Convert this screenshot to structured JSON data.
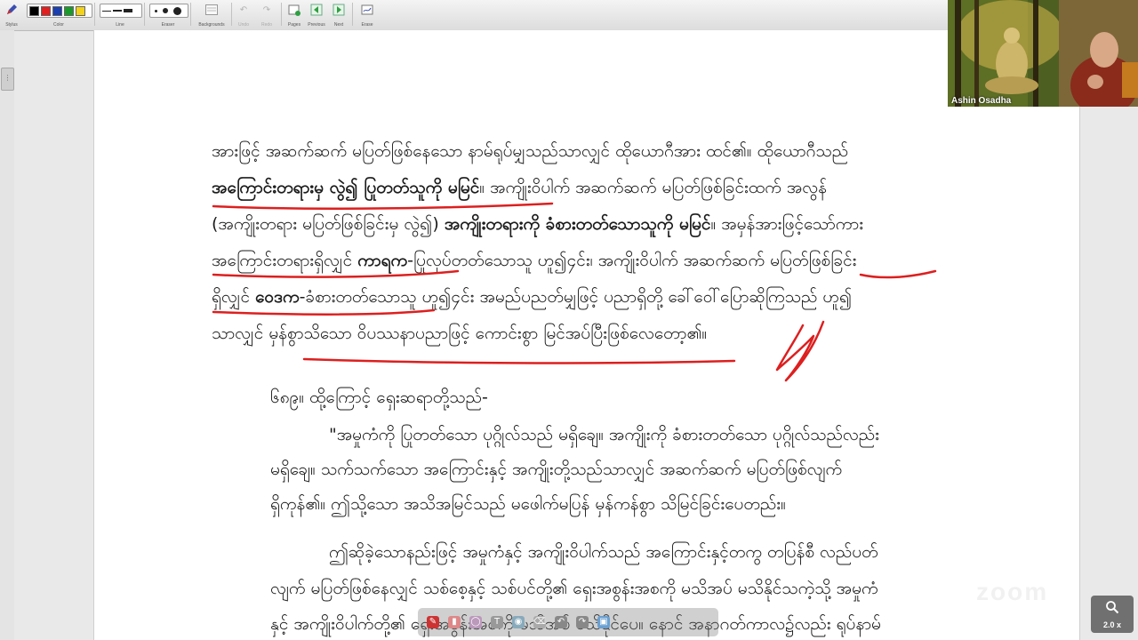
{
  "toolbar": {
    "groups": [
      {
        "label": "Stylus"
      },
      {
        "label": "Color"
      },
      {
        "label": "Line"
      },
      {
        "label": "Eraser"
      },
      {
        "label": "Backgrounds"
      },
      {
        "label": "Undo"
      },
      {
        "label": "Redo"
      },
      {
        "label": "Pages"
      },
      {
        "label": "Previous"
      },
      {
        "label": "Next"
      },
      {
        "label": "Erase"
      }
    ],
    "colors": [
      "#000000",
      "#e02020",
      "#1c3fb0",
      "#1a9a2a",
      "#f2d21b"
    ]
  },
  "video": {
    "participant_name": "Ashin Osadha"
  },
  "zoom": {
    "level": "2.0 x"
  },
  "document": {
    "para1": [
      "အားဖြင့် အဆက်ဆက် မပြတ်ဖြစ်နေသော နာမ်ရုပ်မျှသည်သာလျှင် ထိုယောဂီအား ထင်၏။ ထိုယောဂီသည်",
      "အကြောင်းတရားမှ လွဲ၍ ပြုတတ်သူကို မမြင်",
      "။ အကျိုးဝိပါက် အဆက်ဆက် မပြတ်ဖြစ်ခြင်းထက် အလွန်",
      "(အကျိုးတရား မပြတ်ဖြစ်ခြင်းမှ လွဲ၍)",
      "အကျိုးတရားကို ခံစားတတ်သောသူကို မမြင်",
      "။ အမှန်အားဖြင့်သော်ကား",
      "အကြောင်းတရားရှိလျှင်",
      "ကာရက",
      "-ပြုလုပ်တတ်သောသူ ဟူ၍၄င်း၊ အကျိုးဝိပါက် အဆက်ဆက် မပြတ်ဖြစ်ခြင်း",
      "ရှိလျှင်",
      "ဝေဒက",
      "-ခံစားတတ်သောသူ ဟူ၍၄င်း အမည်ပညတ်မျှဖြင့် ပညာရှိတို့ ခေါ်ဝေါ်ပြောဆိုကြသည် ဟူ၍",
      "သာလျှင် မှန်စွာသိသော ဝိပဿနာပညာဖြင့် ကောင်းစွာ မြင်အပ်ပြီးဖြစ်လေတော့၏။"
    ],
    "para2": {
      "number": "၆၈၉။",
      "intro": "ထို့ကြောင့် ရှေးဆရာတို့သည်-",
      "quote_lines": [
        "\"အမှုကံကို ပြုတတ်သော ပုဂ္ဂိုလ်သည် မရှိချေ။ အကျိုးကို ခံစားတတ်သော ပုဂ္ဂိုလ်သည်လည်း",
        "မရှိချေ။ သက်သက်သော အကြောင်းနှင့် အကျိုးတို့သည်သာလျှင် အဆက်ဆက် မပြတ်ဖြစ်လျက်",
        "ရှိကုန်၏။ ဤသို့သော အသိအမြင်သည် မဖေါက်မပြန် မှန်ကန်စွာ သိမြင်ခြင်းပေတည်း။"
      ]
    },
    "para3": [
      "ဤဆိုခဲ့သောနည်းဖြင့် အမှုကံနှင့် အကျိုးဝိပါက်သည် အကြောင်းနှင့်တကွ တပြန်စီ လည်ပတ်",
      "လျက် မပြတ်ဖြစ်နေလျှင် သစ်စေ့နှင့် သစ်ပင်တို့၏ ရှေးအစွန်းအစကို မသိအပ် မသိနိုင်သကဲ့သို့ အမှုကံ",
      "နှင့် အကျိုးဝိပါက်တို့၏ ရှေးအစွန်းအစကို မသိအပ် မသိနိုင်ပေ။ နောင် အနာဂတ်ကာလ၌လည်း ရုပ်နာမ်"
    ]
  }
}
